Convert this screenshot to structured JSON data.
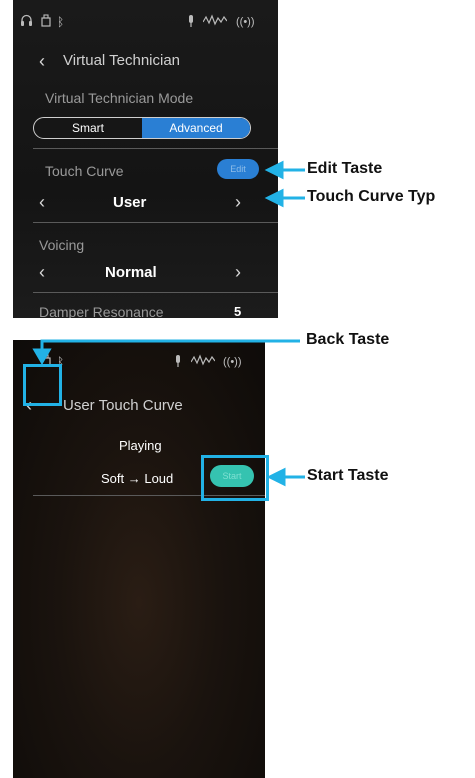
{
  "screen1": {
    "status_icons": [
      "headphones-icon",
      "usb-icon",
      "bluetooth-icon",
      "microphone-icon",
      "audio-icon",
      "wireless-icon"
    ],
    "header_title": "Virtual Technician",
    "mode_label": "Virtual Technician Mode",
    "mode_options": [
      "Smart",
      "Advanced"
    ],
    "mode_selected": "Advanced",
    "touch_curve_label": "Touch Curve",
    "edit_button": "Edit",
    "touch_curve_value": "User",
    "voicing_label": "Voicing",
    "voicing_value": "Normal",
    "damper_label": "Damper Resonance",
    "damper_value": "5"
  },
  "screen2": {
    "status_icons": [
      "usb-icon",
      "bluetooth-icon",
      "microphone-icon",
      "audio-icon",
      "wireless-icon"
    ],
    "header_title": "User Touch Curve",
    "playing_label": "Playing",
    "range_label": "Soft → Loud",
    "start_button": "Start"
  },
  "callouts": {
    "edit": "Edit Taste",
    "touch_curve_type": "Touch Curve Typ",
    "back": "Back Taste",
    "start": "Start Taste"
  },
  "colors": {
    "accent_blue": "#2a7fd4",
    "callout_line": "#22b2e6",
    "start_teal": "#35c3b0"
  }
}
